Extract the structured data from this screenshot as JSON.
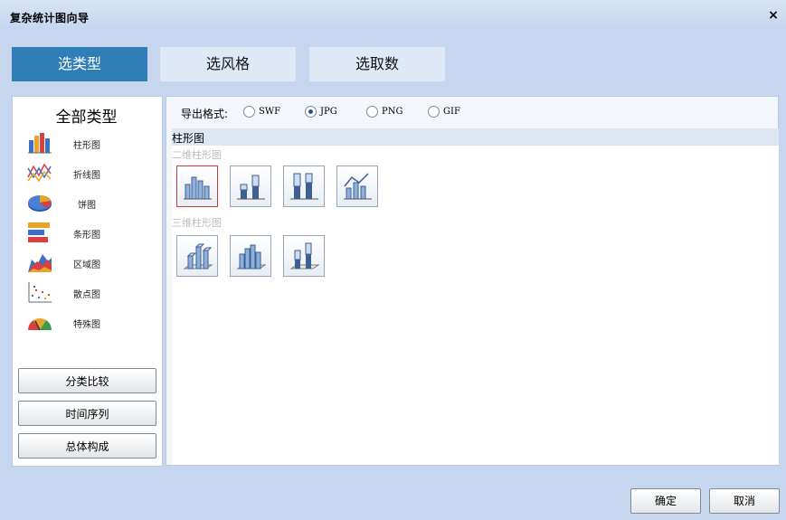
{
  "window": {
    "title": "复杂统计图向导",
    "close_glyph": "×"
  },
  "tabs": [
    {
      "label": "选类型",
      "active": true
    },
    {
      "label": "选风格",
      "active": false
    },
    {
      "label": "选取数",
      "active": false
    }
  ],
  "left_panel": {
    "header": "全部类型",
    "types": [
      {
        "label": "柱形图",
        "icon": "bar-chart-icon"
      },
      {
        "label": "折线图",
        "icon": "line-chart-icon"
      },
      {
        "label": "饼图",
        "icon": "pie-chart-icon"
      },
      {
        "label": "条形图",
        "icon": "horizontal-bar-chart-icon"
      },
      {
        "label": "区域图",
        "icon": "area-chart-icon"
      },
      {
        "label": "散点图",
        "icon": "scatter-chart-icon"
      },
      {
        "label": "特殊图",
        "icon": "gauge-chart-icon"
      }
    ],
    "categories": [
      "分类比较",
      "时间序列",
      "总体构成"
    ]
  },
  "export": {
    "label": "导出格式:",
    "options": [
      "SWF",
      "JPG",
      "PNG",
      "GIF"
    ],
    "selected": "JPG"
  },
  "group": {
    "title": "柱形图",
    "sub_2d": "二维柱形图",
    "sub_3d": "三维柱形图"
  },
  "buttons": {
    "ok": "确定",
    "cancel": "取消"
  },
  "colors": {
    "active_tab": "#2f7eb8",
    "selected_thumb_border": "#d23a3a"
  }
}
